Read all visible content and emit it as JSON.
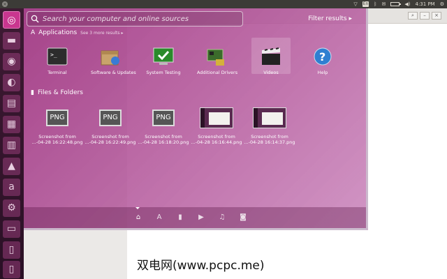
{
  "top_panel": {
    "keyboard_layout": "En",
    "time": "4:31 PM"
  },
  "search": {
    "placeholder": "Search your computer and online sources",
    "filter_label": "Filter results"
  },
  "applications": {
    "title": "Applications",
    "more": "See 3 more results",
    "items": [
      {
        "label": "Terminal",
        "icon": "terminal-icon"
      },
      {
        "label": "Software & Updates",
        "icon": "software-updates-icon"
      },
      {
        "label": "System Testing",
        "icon": "system-testing-icon"
      },
      {
        "label": "Additional Drivers",
        "icon": "additional-drivers-icon"
      },
      {
        "label": "Videos",
        "icon": "videos-icon"
      },
      {
        "label": "Help",
        "icon": "help-icon"
      }
    ]
  },
  "files": {
    "title": "Files & Folders",
    "items": [
      {
        "line1": "Screenshot from",
        "line2": "...-04-28 16:22:48.png",
        "icon": "png-file-icon",
        "thumb_text": "PNG"
      },
      {
        "line1": "Screenshot from",
        "line2": "...-04-28 16:22:49.png",
        "icon": "png-file-icon",
        "thumb_text": "PNG"
      },
      {
        "line1": "Screenshot from",
        "line2": "...-04-28 16:18:20.png",
        "icon": "png-file-icon",
        "thumb_text": "PNG"
      },
      {
        "line1": "Screenshot from",
        "line2": "...-04-28 16:16:44.png",
        "icon": "screenshot-thumbnail"
      },
      {
        "line1": "Screenshot from",
        "line2": "...-04-28 16:14:37.png",
        "icon": "screenshot-thumbnail"
      }
    ]
  },
  "lenses": [
    "home-lens-icon",
    "applications-lens-icon",
    "files-lens-icon",
    "video-lens-icon",
    "music-lens-icon",
    "photo-lens-icon"
  ],
  "watermark": "双电网(www.pcpc.me)",
  "colors": {
    "dash_accent": "#b23c8e",
    "launcher": "#3e1a33",
    "panel": "#3c3b37"
  }
}
